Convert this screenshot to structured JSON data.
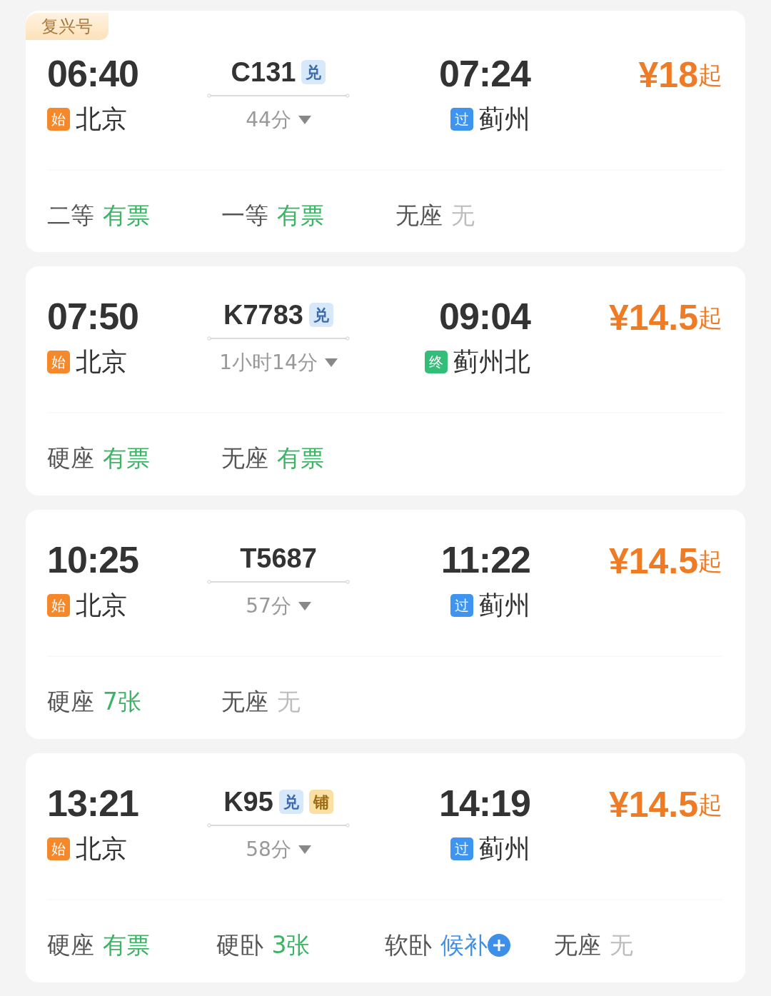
{
  "trains": [
    {
      "badge": "复兴号",
      "depart_time": "06:40",
      "depart_station": {
        "tag": "始",
        "kind": "origin",
        "name": "北京"
      },
      "number": "C131",
      "tags": [
        {
          "text": "兑",
          "kind": "exchange"
        }
      ],
      "duration": "44分",
      "arrive_time": "07:24",
      "arrive_station": {
        "tag": "过",
        "kind": "pass",
        "name": "蓟州"
      },
      "price": "¥18",
      "price_suffix": "起",
      "seats": [
        {
          "class": "二等",
          "status": "有票",
          "kind": "available"
        },
        {
          "class": "一等",
          "status": "有票",
          "kind": "available"
        },
        {
          "class": "无座",
          "status": "无",
          "kind": "none"
        }
      ]
    },
    {
      "depart_time": "07:50",
      "depart_station": {
        "tag": "始",
        "kind": "origin",
        "name": "北京"
      },
      "number": "K7783",
      "tags": [
        {
          "text": "兑",
          "kind": "exchange"
        }
      ],
      "duration": "1小时14分",
      "arrive_time": "09:04",
      "arrive_station": {
        "tag": "终",
        "kind": "terminal",
        "name": "蓟州北"
      },
      "price": "¥14.5",
      "price_suffix": "起",
      "seats": [
        {
          "class": "硬座",
          "status": "有票",
          "kind": "available"
        },
        {
          "class": "无座",
          "status": "有票",
          "kind": "available"
        }
      ]
    },
    {
      "depart_time": "10:25",
      "depart_station": {
        "tag": "始",
        "kind": "origin",
        "name": "北京"
      },
      "number": "T5687",
      "duration": "57分",
      "arrive_time": "11:22",
      "arrive_station": {
        "tag": "过",
        "kind": "pass",
        "name": "蓟州"
      },
      "price": "¥14.5",
      "price_suffix": "起",
      "seats": [
        {
          "class": "硬座",
          "status": "7张",
          "kind": "available"
        },
        {
          "class": "无座",
          "status": "无",
          "kind": "none"
        }
      ]
    },
    {
      "depart_time": "13:21",
      "depart_station": {
        "tag": "始",
        "kind": "origin",
        "name": "北京"
      },
      "number": "K95",
      "tags": [
        {
          "text": "兑",
          "kind": "exchange"
        },
        {
          "text": "铺",
          "kind": "berth"
        }
      ],
      "duration": "58分",
      "arrive_time": "14:19",
      "arrive_station": {
        "tag": "过",
        "kind": "pass",
        "name": "蓟州"
      },
      "price": "¥14.5",
      "price_suffix": "起",
      "seats": [
        {
          "class": "硬座",
          "status": "有票",
          "kind": "available"
        },
        {
          "class": "硬卧",
          "status": "3张",
          "kind": "available"
        },
        {
          "class": "软卧",
          "status": "候补",
          "kind": "waitlist"
        },
        {
          "class": "无座",
          "status": "无",
          "kind": "none"
        }
      ]
    }
  ]
}
